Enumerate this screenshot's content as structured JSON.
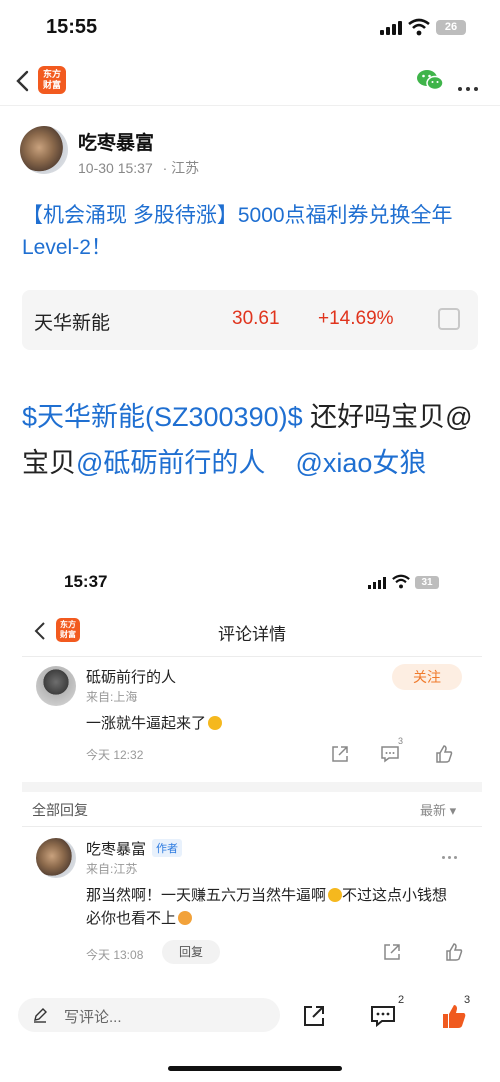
{
  "status_bar": {
    "time": "15:55",
    "battery": "26"
  },
  "nav": {
    "logo_text": "东方\n财富",
    "logo_line1": "东方",
    "logo_line2": "财富"
  },
  "post": {
    "author": "吃枣暴富",
    "datetime": "10-30 15:37",
    "location": "· 江苏",
    "headline": "【机会涌现 多股待涨】5000点福利券兑换全年Level-2！",
    "stock": {
      "name": "天华新能",
      "price": "30.61",
      "change": "+14.69%"
    },
    "body": {
      "stock_link": "$天华新能(SZ300390)$",
      "text1": " 还好吗宝贝@宝贝",
      "mention1": "@砥砺前行的人",
      "mention2": "@xiao女狼"
    }
  },
  "embedded": {
    "time": "15:37",
    "battery": "31",
    "logo_line1": "东方",
    "logo_line2": "财富",
    "title": "评论详情",
    "comment": {
      "name": "砥砺前行的人",
      "from": "来自:上海",
      "follow": "关注",
      "content": "一涨就牛逼起来了",
      "date": "今天 12:32",
      "comment_count": "3"
    },
    "all_replies": "全部回复",
    "sort": "最新 ▾",
    "reply": {
      "name": "吃枣暴富",
      "author_tag": "作者",
      "from": "来自:江苏",
      "content_a": "那当然啊！一天赚五六万当然牛逼啊",
      "content_b": "不过这点小钱想必你也看不上",
      "date": "今天 13:08",
      "reply_button": "回复"
    }
  },
  "bottom_bar": {
    "placeholder": "写评论...",
    "comment_count": "2",
    "like_count": "3"
  },
  "colors": {
    "link": "#1f6fd1",
    "up": "#e0341d",
    "brand": "#f25a1f",
    "like": "#f05a1f"
  }
}
